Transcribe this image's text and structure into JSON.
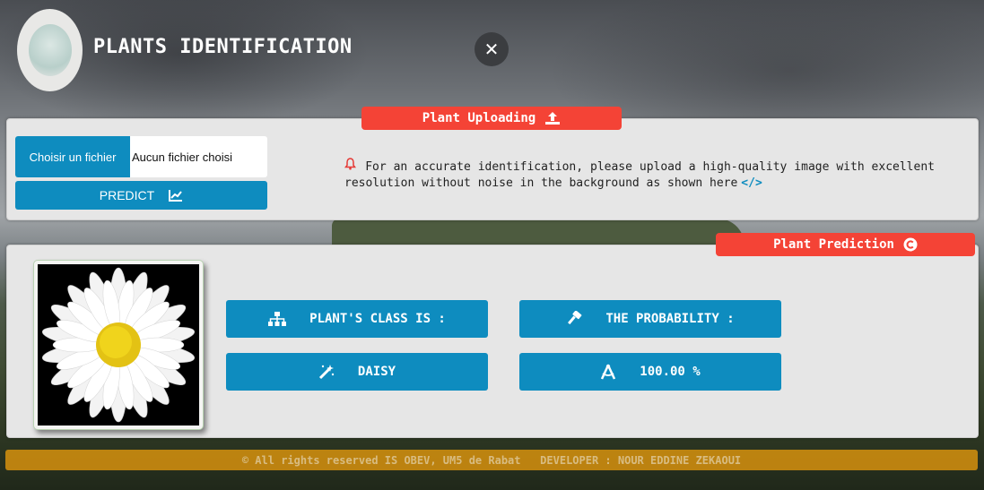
{
  "header": {
    "title": "PLANTS IDENTIFICATION",
    "close_symbol": "✕"
  },
  "upload": {
    "tab_label": "Plant Uploading",
    "file_button_label": "Choisir un fichier",
    "file_status": "Aucun fichier choisi",
    "predict_label": "PREDICT",
    "notice_text": "For an accurate identification, please upload a high-quality image with excellent resolution without noise in the background as shown here",
    "notice_link_symbol": "</>"
  },
  "prediction": {
    "tab_label": "Plant Prediction",
    "class_heading": "PLANT'S CLASS IS :",
    "probability_heading": "THE PROBABILITY :",
    "class_value": "DAISY",
    "probability_value": "100.00 %"
  },
  "footer": {
    "text": "© All rights reserved IS OBEV, UM5 de Rabat   DEVELOPER : NOUR EDDINE ZEKAOUI"
  },
  "colors": {
    "accent_blue": "#0e8cbf",
    "tab_red": "#f44336",
    "footer_orange": "#c98a0f",
    "panel_bg": "#e6e6e6"
  },
  "icons": {
    "upload_tab": "upload-icon",
    "predict_tab": "copyright-icon",
    "predict_button": "chart-icon",
    "notice": "bell-icon",
    "notice_link": "code-icon",
    "class_heading": "sitemap-icon",
    "probability_heading": "hammer-icon",
    "class_value": "magic-wand-icon",
    "probability_value": "compass-icon"
  }
}
